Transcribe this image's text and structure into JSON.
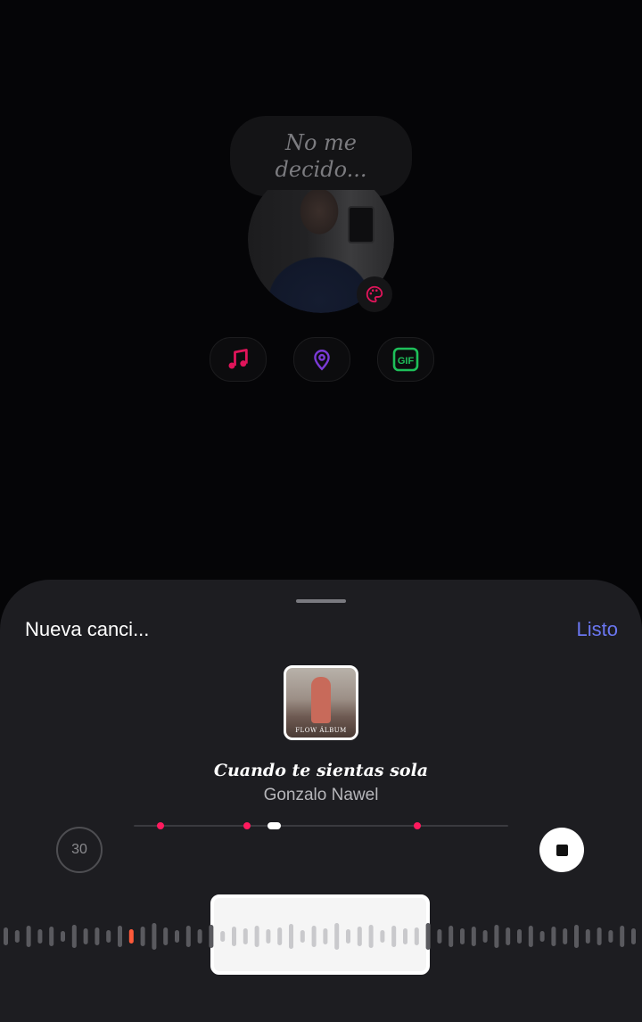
{
  "status_text": "No me decido...",
  "tools": [
    {
      "name": "music",
      "color": "#e0145a"
    },
    {
      "name": "location",
      "color": "#7a3ad6"
    },
    {
      "name": "gif",
      "color": "#1ec05a",
      "label": "GIF"
    }
  ],
  "sheet": {
    "title": "Nueva canci...",
    "done_label": "Listo"
  },
  "song": {
    "cover_text": "FLOW ÁLBUM",
    "title": "Cuando te sientas sola",
    "artist": "Gonzalo Nawel"
  },
  "player": {
    "duration": "30",
    "accent_color": "#ff1a5e"
  }
}
